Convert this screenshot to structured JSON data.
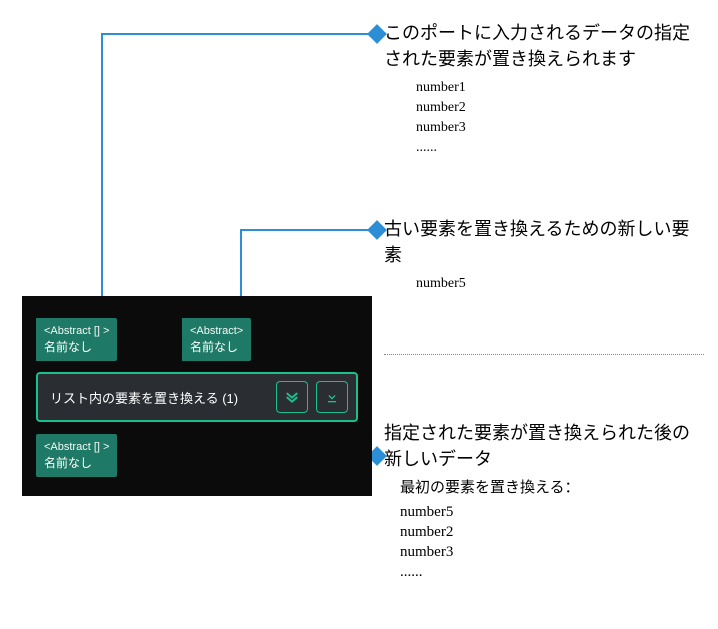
{
  "anno1": {
    "text": "このポートに入力されるデータの指定された要素が置き換えられます",
    "list": [
      "number1",
      "number2",
      "number3",
      "......"
    ]
  },
  "anno2": {
    "text": "古い要素を置き換えるための新しい要素",
    "list": [
      "number5"
    ]
  },
  "anno3": {
    "text": "指定された要素が置き換えられた後の新しいデータ",
    "header": "最初の要素を置き換える：",
    "list": [
      "number5",
      "number2",
      "number3",
      "......"
    ]
  },
  "node": {
    "in1_type": "<Abstract [] >",
    "in1_name": "名前なし",
    "in2_type": "<Abstract>",
    "in2_name": "名前なし",
    "title": "リスト内の要素を置き換える (1)",
    "out_type": "<Abstract [] >",
    "out_name": "名前なし"
  }
}
